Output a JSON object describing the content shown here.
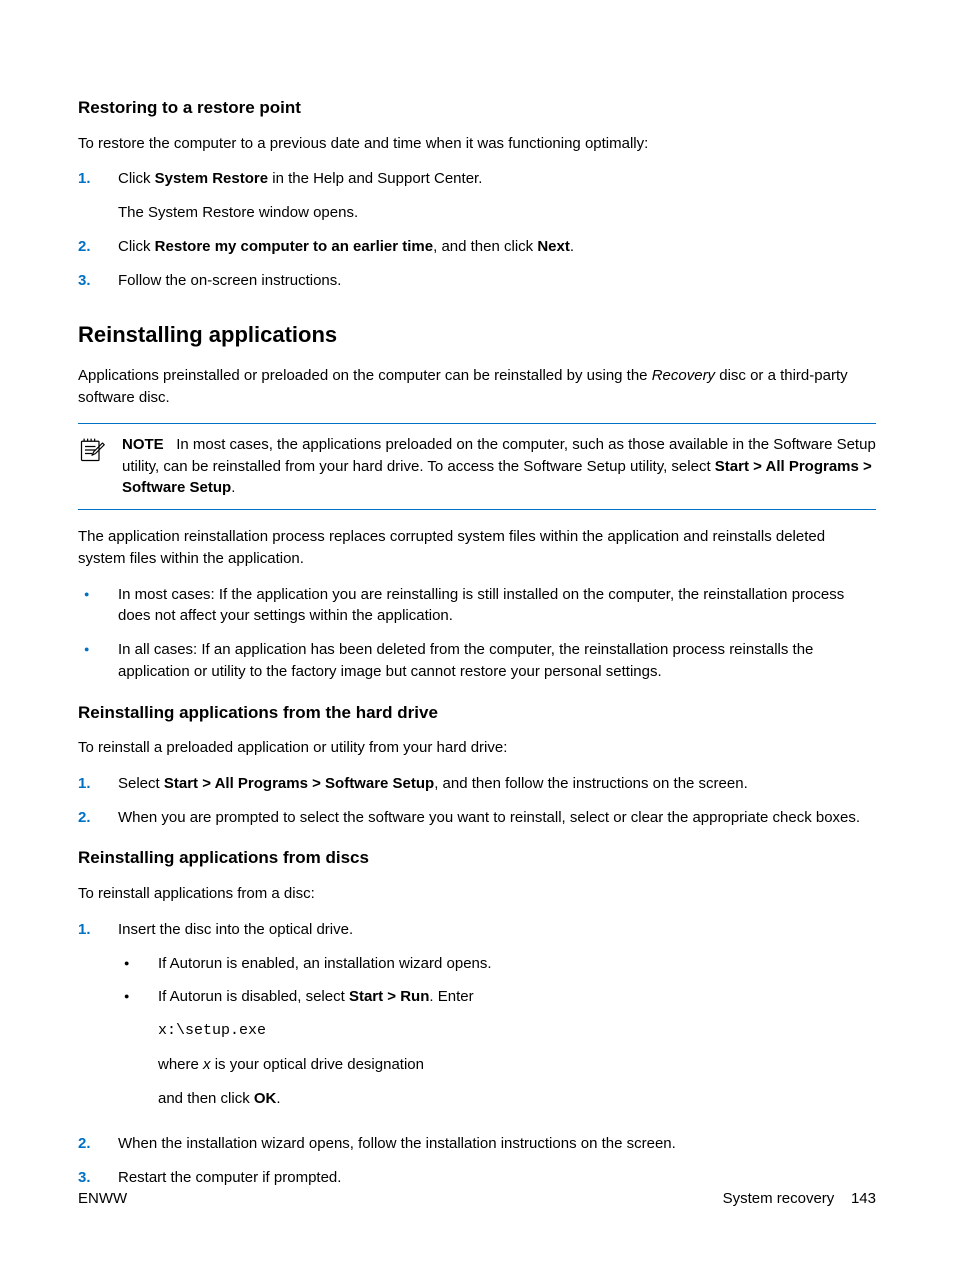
{
  "section1": {
    "heading": "Restoring to a restore point",
    "intro": "To restore the computer to a previous date and time when it was functioning optimally:",
    "steps": [
      {
        "num": "1.",
        "pre": "Click ",
        "bold": "System Restore",
        "post": " in the Help and Support Center.",
        "extra": "The System Restore window opens."
      },
      {
        "num": "2.",
        "pre": "Click ",
        "bold": "Restore my computer to an earlier time",
        "post": ", and then click ",
        "bold2": "Next",
        "post2": "."
      },
      {
        "num": "3.",
        "text": "Follow the on-screen instructions."
      }
    ]
  },
  "section2": {
    "heading": "Reinstalling applications",
    "intro_pre": "Applications preinstalled or preloaded on the computer can be reinstalled by using the ",
    "intro_italic": "Recovery",
    "intro_post": " disc or a third-party software disc.",
    "note": {
      "label": "NOTE",
      "body_pre": "In most cases, the applications preloaded on the computer, such as those available in the Software Setup utility, can be reinstalled from your hard drive. To access the Software Setup utility, select ",
      "body_bold": "Start > All Programs > Software Setup",
      "body_post": "."
    },
    "para2": "The application reinstallation process replaces corrupted system files within the application and reinstalls deleted system files within the application.",
    "bullets": [
      "In most cases: If the application you are reinstalling is still installed on the computer, the reinstallation process does not affect your settings within the application.",
      "In all cases: If an application has been deleted from the computer, the reinstallation process reinstalls the application or utility to the factory image but cannot restore your personal settings."
    ]
  },
  "section3": {
    "heading": "Reinstalling applications from the hard drive",
    "intro": "To reinstall a preloaded application or utility from your hard drive:",
    "steps": [
      {
        "num": "1.",
        "pre": "Select ",
        "bold": "Start > All Programs > Software Setup",
        "post": ", and then follow the instructions on the screen."
      },
      {
        "num": "2.",
        "text": "When you are prompted to select the software you want to reinstall, select or clear the appropriate check boxes."
      }
    ]
  },
  "section4": {
    "heading": "Reinstalling applications from discs",
    "intro": "To reinstall applications from a disc:",
    "step1": {
      "num": "1.",
      "text": "Insert the disc into the optical drive.",
      "sub_a": "If Autorun is enabled, an installation wizard opens.",
      "sub_b_pre": "If Autorun is disabled, select ",
      "sub_b_bold": "Start > Run",
      "sub_b_post": ". Enter",
      "code": "x:\\setup.exe",
      "where_pre": "where ",
      "where_italic": "x",
      "where_post": " is your optical drive designation",
      "then_pre": "and then click ",
      "then_bold": "OK",
      "then_post": "."
    },
    "step2": {
      "num": "2.",
      "text": "When the installation wizard opens, follow the installation instructions on the screen."
    },
    "step3": {
      "num": "3.",
      "text": "Restart the computer if prompted."
    }
  },
  "footer": {
    "left": "ENWW",
    "right_label": "System recovery",
    "page": "143"
  }
}
